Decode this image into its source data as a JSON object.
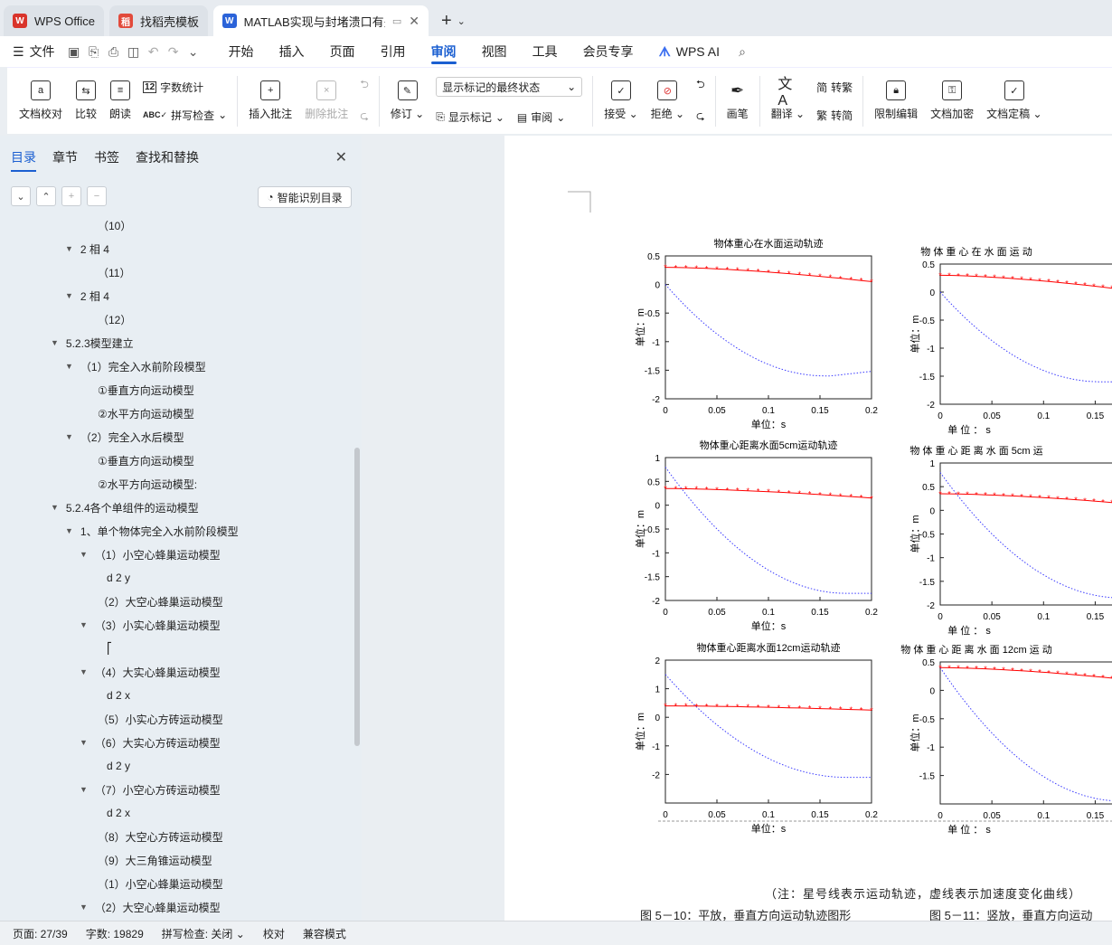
{
  "tabs": [
    {
      "label": "WPS Office",
      "color": "#d9342b",
      "icon": "W"
    },
    {
      "label": "找稻壳模板",
      "color": "#e24a3b",
      "icon": "稻"
    },
    {
      "label": "MATLAB实现与封堵溃口有关",
      "color": "#2b63d9",
      "icon": "W"
    }
  ],
  "menu": {
    "file": "文件",
    "items": [
      "开始",
      "插入",
      "页面",
      "引用",
      "审阅",
      "视图",
      "工具",
      "会员专享"
    ],
    "active": "审阅",
    "ai": "WPS AI"
  },
  "ribbon": {
    "doc_check": "文档校对",
    "compare": "比较",
    "read_aloud": "朗读",
    "word_count": "字数统计",
    "spell_check": "拼写检查",
    "insert_comment": "插入批注",
    "delete_comment": "删除批注",
    "revise": "修订",
    "markup_state": "显示标记的最终状态",
    "show_markup": "显示标记",
    "review": "审阅",
    "accept": "接受",
    "reject": "拒绝",
    "pen": "画笔",
    "translate": "翻译",
    "to_traditional": "转繁",
    "to_simplified": "转简",
    "restrict_edit": "限制编辑",
    "encrypt": "文档加密",
    "finalize": "文档定稿"
  },
  "panel": {
    "tabs": [
      "目录",
      "章节",
      "书签",
      "查找和替换"
    ],
    "active_tab": "目录",
    "ai_toc": "智能识别目录",
    "toc": [
      {
        "t": "（10）",
        "l": 3,
        "a": false
      },
      {
        "t": "2 相 4",
        "l": 2,
        "a": true
      },
      {
        "t": "（11）",
        "l": 3,
        "a": false
      },
      {
        "t": "2 相 4",
        "l": 2,
        "a": true
      },
      {
        "t": "（12）",
        "l": 3,
        "a": false
      },
      {
        "t": "5.2.3模型建立",
        "l": 1,
        "a": true
      },
      {
        "t": "（1）完全入水前阶段模型",
        "l": 2,
        "a": true
      },
      {
        "t": "①垂直方向运动模型",
        "l": 3,
        "a": false
      },
      {
        "t": "②水平方向运动模型",
        "l": 3,
        "a": false
      },
      {
        "t": "（2）完全入水后模型",
        "l": 2,
        "a": true
      },
      {
        "t": "①垂直方向运动模型",
        "l": 3,
        "a": false
      },
      {
        "t": "②水平方向运动模型:",
        "l": 3,
        "a": false
      },
      {
        "t": "5.2.4各个单组件的运动模型",
        "l": 1,
        "a": true
      },
      {
        "t": "1、单个物体完全入水前阶段模型",
        "l": 2,
        "a": true
      },
      {
        "t": "（1）小空心蜂巢运动模型",
        "l": 3,
        "a": true
      },
      {
        "t": "d 2 y",
        "l": 4,
        "a": false
      },
      {
        "t": "（2）大空心蜂巢运动模型",
        "l": 3,
        "a": false
      },
      {
        "t": "（3）小实心蜂巢运动模型",
        "l": 3,
        "a": true
      },
      {
        "t": "⎡",
        "l": 4,
        "a": false
      },
      {
        "t": "（4）大实心蜂巢运动模型",
        "l": 3,
        "a": true
      },
      {
        "t": "d 2 x",
        "l": 4,
        "a": false
      },
      {
        "t": "（5）小实心方砖运动模型",
        "l": 3,
        "a": false
      },
      {
        "t": "（6）大实心方砖运动模型",
        "l": 3,
        "a": true
      },
      {
        "t": "d 2 y",
        "l": 4,
        "a": false
      },
      {
        "t": "（7）小空心方砖运动模型",
        "l": 3,
        "a": true
      },
      {
        "t": "d 2 x",
        "l": 4,
        "a": false
      },
      {
        "t": "（8）大空心方砖运动模型",
        "l": 3,
        "a": false
      },
      {
        "t": "（9）大三角锥运动模型",
        "l": 3,
        "a": false
      },
      {
        "t": "（1）小空心蜂巢运动模型",
        "l": 3,
        "a": false
      },
      {
        "t": "（2）大空心蜂巢运动模型",
        "l": 3,
        "a": true
      }
    ]
  },
  "document": {
    "charts": [
      {
        "title": "物体重心在水面运动轨迹",
        "ylim": [
          -2,
          0.5
        ],
        "yticks": [
          "0.5",
          "0",
          "-0.5",
          "-1",
          "-1.5",
          "-2"
        ],
        "ylabel": "单位：m",
        "xlabel": "单位：s",
        "xticks": [
          "0",
          "0.05",
          "0.1",
          "0.15",
          "0.2"
        ]
      },
      {
        "title": "物 体 重 心 在 水 面 运 动",
        "ylim": [
          -2,
          0.5
        ],
        "yticks": [
          "0.5",
          "0",
          "-0.5",
          "-1",
          "-1.5",
          "-2"
        ],
        "ylabel": "单位：m",
        "xlabel": "单 位 ： s",
        "xticks": [
          "0",
          "0.05",
          "0.1",
          "0.15"
        ]
      },
      {
        "title": "物体重心距离水面5cm运动轨迹",
        "ylim": [
          -2,
          1
        ],
        "yticks": [
          "1",
          "0.5",
          "0",
          "-0.5",
          "-1",
          "-1.5",
          "-2"
        ],
        "ylabel": "单位：m",
        "xlabel": "单位：s",
        "xticks": [
          "0",
          "0.05",
          "0.1",
          "0.15",
          "0.2"
        ]
      },
      {
        "title": "物 体 重 心 距 离 水 面 5cm 运",
        "ylim": [
          -2,
          1
        ],
        "yticks": [
          "1",
          "0.5",
          "0",
          "-0.5",
          "-1",
          "-1.5",
          "-2"
        ],
        "ylabel": "单位：m",
        "xlabel": "单 位 ： s",
        "xticks": [
          "0",
          "0.05",
          "0.1",
          "0.15"
        ]
      },
      {
        "title": "物体重心距离水面12cm运动轨迹",
        "ylim": [
          -3,
          2
        ],
        "yticks": [
          "2",
          "1",
          "0",
          "-1",
          "-2"
        ],
        "ylabel": "单位：m",
        "xlabel": "单位：s",
        "xticks": [
          "0",
          "0.05",
          "0.1",
          "0.15",
          "0.2"
        ]
      },
      {
        "title": "物 体 重 心 距 离 水 面 12cm 运 动",
        "ylim": [
          -2,
          0.5
        ],
        "yticks": [
          "0.5",
          "0",
          "-0.5",
          "-1",
          "-1.5"
        ],
        "ylabel": "单位：m",
        "xlabel": "单 位 ： s",
        "xticks": [
          "0",
          "0.05",
          "0.1",
          "0.15"
        ]
      }
    ],
    "note": "（注：星号线表示运动轨迹，虚线表示加速度变化曲线）",
    "caption_left": "图 5－10：平放，垂直方向运动轨迹图形",
    "caption_right": "图 5－11：竖放，垂直方向运动"
  },
  "status": {
    "page": "页面: 27/39",
    "words": "字数: 19829",
    "spell": "拼写检查: 关闭",
    "proof": "校对",
    "compat": "兼容模式"
  },
  "colors": {
    "accent": "#1b5fd1",
    "trajectory": "#ff0000",
    "acceleration": "#3b3bff"
  }
}
